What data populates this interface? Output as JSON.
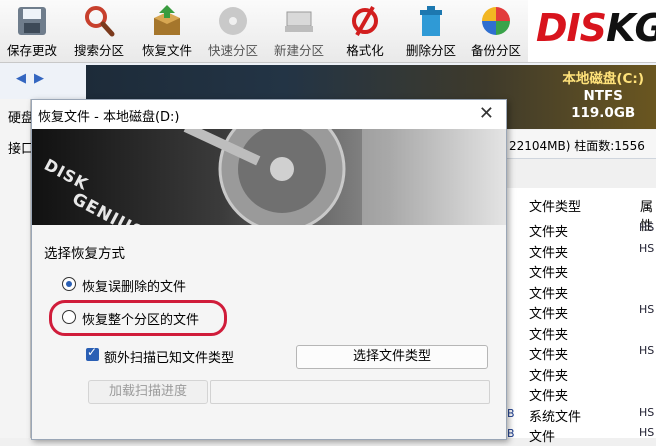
{
  "toolbar": {
    "items": [
      {
        "label": "保存更改",
        "icon": "save-icon"
      },
      {
        "label": "搜索分区",
        "icon": "search-icon"
      },
      {
        "label": "恢复文件",
        "icon": "recover-box-icon"
      },
      {
        "label": "快速分区",
        "icon": "disk-icon"
      },
      {
        "label": "新建分区",
        "icon": "new-partition-icon"
      },
      {
        "label": "格式化",
        "icon": "format-icon"
      },
      {
        "label": "删除分区",
        "icon": "trash-icon"
      },
      {
        "label": "备份分区",
        "icon": "backup-pie-icon"
      }
    ],
    "logo_text_red": "DIS",
    "logo_text_dark": "KGE"
  },
  "disk_info": {
    "name": "本地磁盘(C:)",
    "fs": "NTFS",
    "size": "119.0GB"
  },
  "left_labels": [
    "硬盘",
    "接口"
  ],
  "info_row": {
    "text": "22104MB)  柱面数:1556"
  },
  "table": {
    "headers": [
      "文件类型",
      "属性"
    ],
    "rows": [
      {
        "type": "文件夹",
        "attr": "HS",
        "b": ""
      },
      {
        "type": "文件夹",
        "attr": "HS",
        "b": ""
      },
      {
        "type": "文件夹",
        "attr": "",
        "b": ""
      },
      {
        "type": "文件夹",
        "attr": "",
        "b": ""
      },
      {
        "type": "文件夹",
        "attr": "HS",
        "b": ""
      },
      {
        "type": "文件夹",
        "attr": "",
        "b": ""
      },
      {
        "type": "文件夹",
        "attr": "HS",
        "b": ""
      },
      {
        "type": "文件夹",
        "attr": "",
        "b": ""
      },
      {
        "type": "文件夹",
        "attr": "",
        "b": ""
      },
      {
        "type": "系统文件",
        "attr": "HS",
        "b": "B"
      },
      {
        "type": "文件",
        "attr": "HS",
        "b": "B"
      }
    ]
  },
  "dialog": {
    "title": "恢复文件 - 本地磁盘(D:)",
    "close": "✕",
    "banner_text_1": "DISK",
    "banner_text_2": "GENIUS",
    "section_title": "选择恢复方式",
    "option_deleted": "恢复误删除的文件",
    "option_whole": "恢复整个分区的文件",
    "checkbox_label": "额外扫描已知文件类型",
    "select_types_button": "选择文件类型",
    "load_progress_button": "加载扫描进度"
  },
  "colors": {
    "accent": "#2a5fb4",
    "highlight_oval": "#d01c3a",
    "logo_red": "#d8141d"
  }
}
